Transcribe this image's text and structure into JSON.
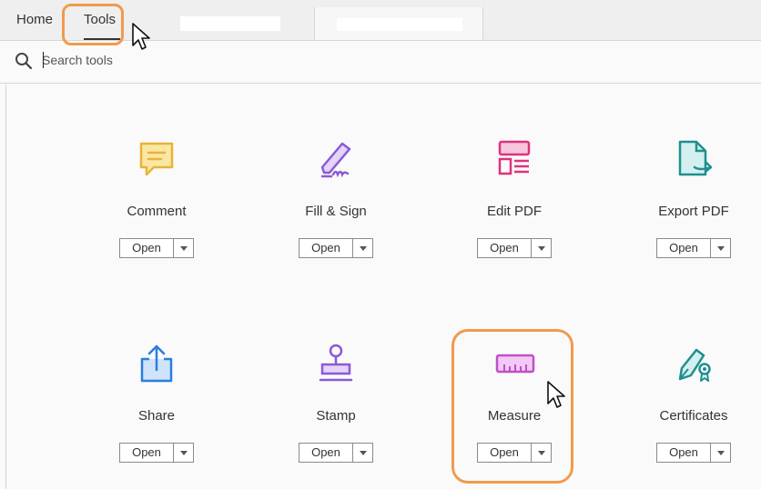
{
  "tabs": {
    "home_label": "Home",
    "tools_label": "Tools"
  },
  "search": {
    "placeholder": "Search tools",
    "value": ""
  },
  "tools": [
    {
      "label": "Comment",
      "icon": "comment-icon",
      "color": "#e8b33a",
      "open_label": "Open"
    },
    {
      "label": "Fill & Sign",
      "icon": "fill-sign-icon",
      "color": "#8a5ad6",
      "open_label": "Open"
    },
    {
      "label": "Edit PDF",
      "icon": "edit-pdf-icon",
      "color": "#e0317e",
      "open_label": "Open"
    },
    {
      "label": "Export PDF",
      "icon": "export-pdf-icon",
      "color": "#1f8f8f",
      "open_label": "Open"
    },
    {
      "label": "Share",
      "icon": "share-icon",
      "color": "#2b7de0",
      "open_label": "Open"
    },
    {
      "label": "Stamp",
      "icon": "stamp-icon",
      "color": "#8a5ad6",
      "open_label": "Open"
    },
    {
      "label": "Measure",
      "icon": "ruler-icon",
      "color": "#c04fc9",
      "open_label": "Open"
    },
    {
      "label": "Certificates",
      "icon": "certificate-pen-icon",
      "color": "#1f8f8f",
      "open_label": "Open"
    }
  ],
  "highlight_color": "#f29a4d"
}
